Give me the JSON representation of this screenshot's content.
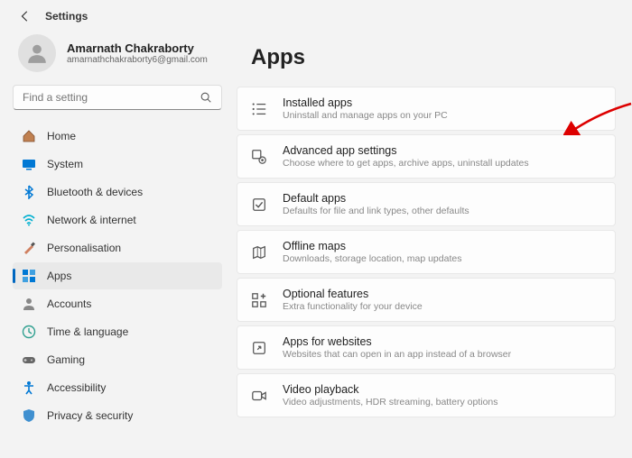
{
  "header": {
    "title": "Settings"
  },
  "user": {
    "name": "Amarnath Chakraborty",
    "email": "amarnathchakraborty6@gmail.com"
  },
  "search": {
    "placeholder": "Find a setting"
  },
  "nav": [
    {
      "label": "Home",
      "icon": "home"
    },
    {
      "label": "System",
      "icon": "system"
    },
    {
      "label": "Bluetooth & devices",
      "icon": "bluetooth"
    },
    {
      "label": "Network & internet",
      "icon": "wifi"
    },
    {
      "label": "Personalisation",
      "icon": "brush"
    },
    {
      "label": "Apps",
      "icon": "apps",
      "active": true
    },
    {
      "label": "Accounts",
      "icon": "account"
    },
    {
      "label": "Time & language",
      "icon": "clock"
    },
    {
      "label": "Gaming",
      "icon": "gamepad"
    },
    {
      "label": "Accessibility",
      "icon": "accessibility"
    },
    {
      "label": "Privacy & security",
      "icon": "shield"
    }
  ],
  "page": {
    "title": "Apps"
  },
  "cards": [
    {
      "title": "Installed apps",
      "desc": "Uninstall and manage apps on your PC",
      "icon": "list"
    },
    {
      "title": "Advanced app settings",
      "desc": "Choose where to get apps, archive apps, uninstall updates",
      "icon": "gear-app"
    },
    {
      "title": "Default apps",
      "desc": "Defaults for file and link types, other defaults",
      "icon": "default"
    },
    {
      "title": "Offline maps",
      "desc": "Downloads, storage location, map updates",
      "icon": "map"
    },
    {
      "title": "Optional features",
      "desc": "Extra functionality for your device",
      "icon": "plus-grid"
    },
    {
      "title": "Apps for websites",
      "desc": "Websites that can open in an app instead of a browser",
      "icon": "share"
    },
    {
      "title": "Video playback",
      "desc": "Video adjustments, HDR streaming, battery options",
      "icon": "video"
    }
  ]
}
